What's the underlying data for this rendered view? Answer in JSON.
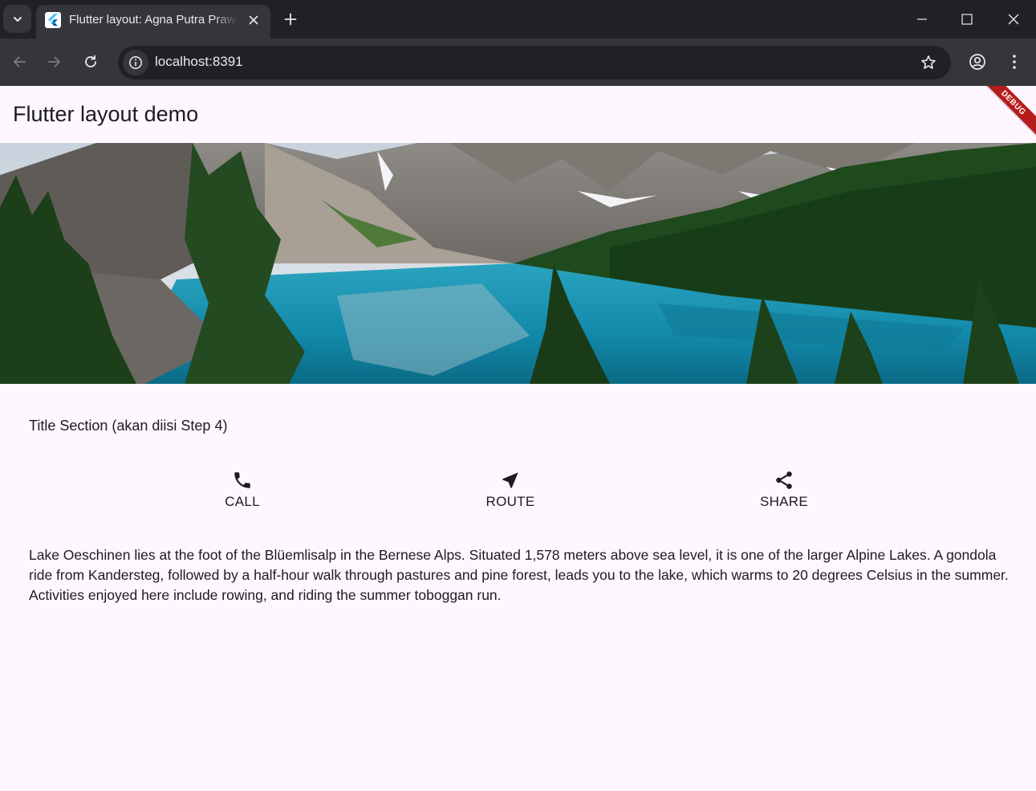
{
  "browser": {
    "tab_title": "Flutter layout: Agna Putra Prawira",
    "url": "localhost:8391"
  },
  "app": {
    "title": "Flutter layout demo",
    "debug_banner": "DEBUG"
  },
  "title_section": "Title Section (akan diisi Step 4)",
  "buttons": [
    {
      "label": "CALL",
      "icon": "phone-icon"
    },
    {
      "label": "ROUTE",
      "icon": "near-me-icon"
    },
    {
      "label": "SHARE",
      "icon": "share-icon"
    }
  ],
  "description": "Lake Oeschinen lies at the foot of the Blüemlisalp in the Bernese Alps. Situated 1,578 meters above sea level, it is one of the larger Alpine Lakes. A gondola ride from Kandersteg, followed by a half-hour walk through pastures and pine forest, leads you to the lake, which warms to 20 degrees Celsius in the summer. Activities enjoyed here include rowing, and riding the summer toboggan run.",
  "colors": {
    "surface": "#fef7ff",
    "on_surface": "#1d1b20",
    "chrome_dark": "#202124",
    "chrome_toolbar": "#35363a",
    "debug_red": "#b71c1c"
  }
}
